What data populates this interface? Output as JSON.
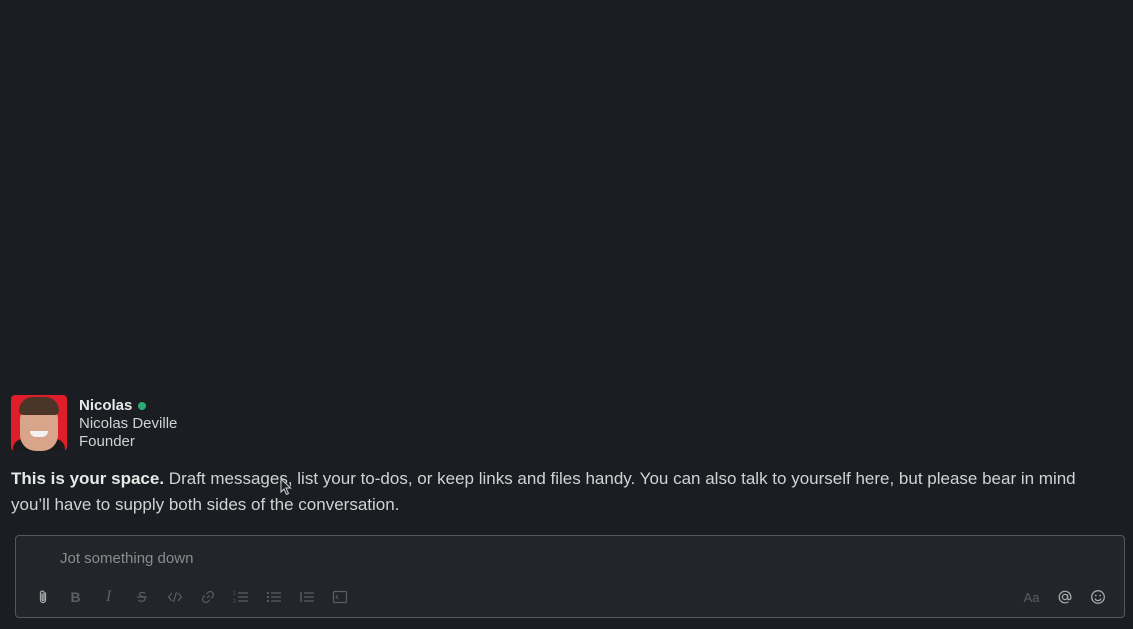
{
  "profile": {
    "display_name": "Nicolas",
    "full_name": "Nicolas Deville",
    "title": "Founder",
    "presence": "active",
    "presence_color": "#2bac76",
    "avatar_bg": "#e01e2b"
  },
  "intro": {
    "lead": "This is your space.",
    "body": "Draft messages, list your to-dos, or keep links and files handy. You can also talk to yourself here, but please bear in mind you’ll have to supply both sides of the conversation."
  },
  "composer": {
    "placeholder": "Jot something down",
    "value": "",
    "toolbar_left": [
      "attach-icon",
      "bold-icon",
      "italic-icon",
      "strikethrough-icon",
      "code-icon",
      "link-icon",
      "ordered-list-icon",
      "bulleted-list-icon",
      "blockquote-icon",
      "code-block-icon"
    ],
    "toolbar_right": [
      "format-text-icon",
      "mention-icon",
      "emoji-icon"
    ],
    "format_label": "Aa",
    "bold_label": "B",
    "italic_label": "I"
  },
  "colors": {
    "background": "#1a1d21",
    "composer_bg": "#222529",
    "text": "#d1d2d3"
  }
}
